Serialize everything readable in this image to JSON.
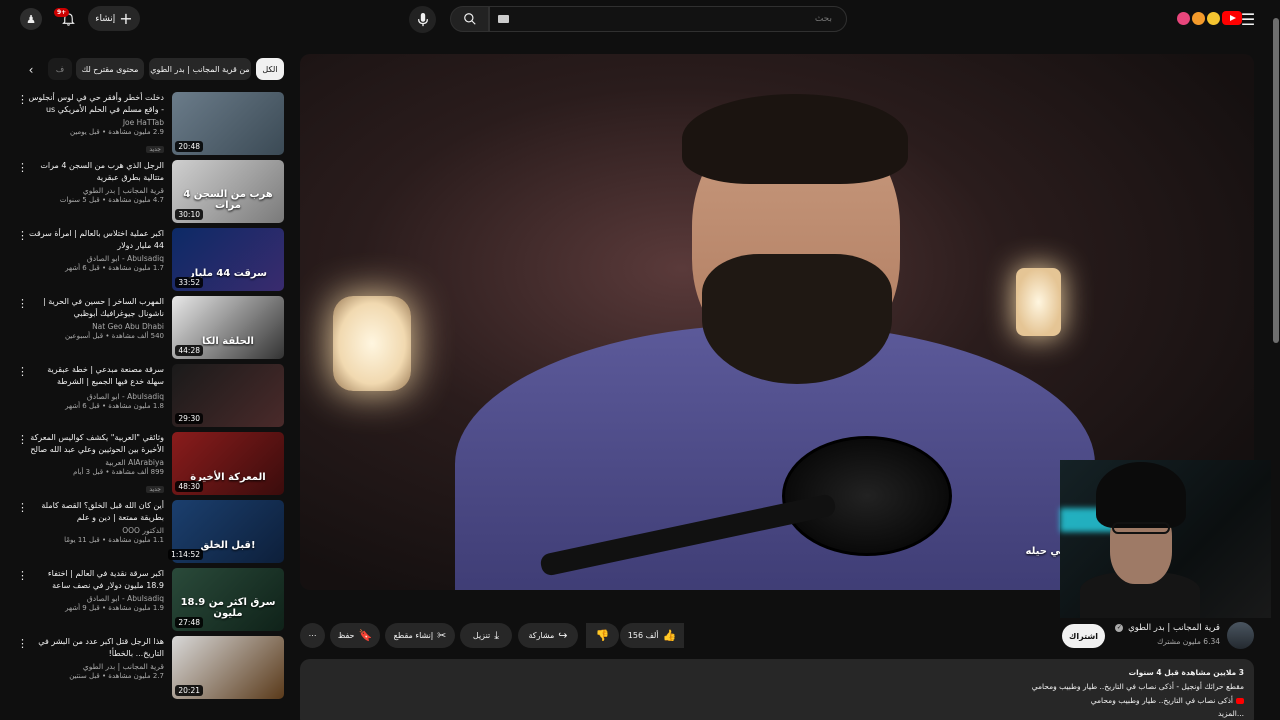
{
  "topbar": {
    "search_placeholder": "بحث",
    "create_label": "إنشاء",
    "notifications_badge": "9+",
    "colors": {
      "brand": "#ff0000",
      "badge": "#cc0000"
    }
  },
  "chips": [
    "الكل",
    "من قرية المجانب | بدر الطوي",
    "محتوى مقترح لك",
    "ف"
  ],
  "recommendations": [
    {
      "title": "دخلت أخطر وأفقر حي في لوس أنجلوس - واقع مسلم في الحلم الأمريكي us",
      "channel": "Joe HaTTab",
      "meta": "2.9 مليون مشاهدة • قبل يومين",
      "tag": "جديد",
      "duration": "20:48",
      "colors": [
        "#6b7c8a",
        "#3b4a55"
      ],
      "thumb_text": ""
    },
    {
      "title": "الرجل الذي هرب من السجن 4 مرات متتالية بطرق عبقرية",
      "channel": "قرية المجانب | بدر الطوي",
      "meta": "4.7 مليون مشاهدة • قبل 5 سنوات",
      "tag": "",
      "duration": "30:10",
      "colors": [
        "#cfcfcf",
        "#7a7a7a"
      ],
      "thumb_text": "هرب من السجن 4 مرات"
    },
    {
      "title": "اكبر عملية اختلاس بالعالم | امرأة سرقت 44 مليار دولار",
      "channel": "Abulsadiq - ابو الصادق",
      "meta": "1.7 مليون مشاهدة • قبل 6 أشهر",
      "tag": "",
      "duration": "33:52",
      "colors": [
        "#0c2a66",
        "#3a2b6e"
      ],
      "thumb_text": "سرقت 44 مليار"
    },
    {
      "title": "المهرب الساخر | حسين في الحرية | ناشونال جيوغرافيك أبوظبي",
      "channel": "Nat Geo Abu Dhabi",
      "meta": "540 ألف مشاهدة • قبل أسبوعين",
      "tag": "",
      "duration": "44:28",
      "colors": [
        "#e8e8e8",
        "#333"
      ],
      "thumb_text": "الحلقة الكا"
    },
    {
      "title": "سرقة مصنعة مبدعي | خطة عبقرية سهلة خدع فيها الجميع | الشرطة والمسابقة",
      "channel": "Abulsadiq - ابو الصادق",
      "meta": "1.8 مليون مشاهدة • قبل 6 أشهر",
      "tag": "",
      "duration": "29:30",
      "colors": [
        "#1a1a1a",
        "#4a2a2a"
      ],
      "thumb_text": ""
    },
    {
      "title": "وثائقي \"العربية\" يكشف كواليس المعركة الأخيرة بين الحوثيين وعلي عبد الله صالح",
      "channel": "AlArabiya العربية",
      "meta": "899 ألف مشاهدة • قبل 3 أيام",
      "tag": "جديد",
      "duration": "48:30",
      "colors": [
        "#8a1c1c",
        "#3a0c0c"
      ],
      "thumb_text": "المعركة الأخيرة"
    },
    {
      "title": "أين كان الله قبل الخلق؟ القصة كاملة بطريقة ممتعة | دين و علم",
      "channel": "الدكتور OOO",
      "meta": "1.1 مليون مشاهدة • قبل 11 يومًا",
      "tag": "",
      "duration": "1:14:52",
      "colors": [
        "#1b3f6e",
        "#0d1f3a"
      ],
      "thumb_text": "قبل الخلق!"
    },
    {
      "title": "اكبر سرقة نقدية في العالم | اختفاء 18.9 مليون دولار في نصف ساعة",
      "channel": "Abulsadiq - ابو الصادق",
      "meta": "1.9 مليون مشاهدة • قبل 9 أشهر",
      "tag": "",
      "duration": "27:48",
      "colors": [
        "#2a4a3a",
        "#0f2219"
      ],
      "thumb_text": "سرق اكثر من 18.9 مليون"
    },
    {
      "title": "هذا الرجل قتل اكبر عدد من البشر في التاريخ... بالخطأ!",
      "channel": "قرية المجانب | بدر الطوي",
      "meta": "2.7 مليون مشاهدة • قبل سنتين",
      "tag": "",
      "duration": "20:21",
      "colors": [
        "#d8d8d8",
        "#5a3a1a"
      ],
      "thumb_text": ""
    }
  ],
  "video": {
    "caption": "لا تنتهي حيله",
    "channel_name": "قرية المجانب | بدر الطوي",
    "channel_subs": "6.34 مليون مشترك",
    "subscribe_label": "اشتراك",
    "likes": "156 ألف",
    "share_label": "مشاركة",
    "download_label": "تنزيل",
    "clip_label": "إنشاء مقطع",
    "save_label": "حفظ"
  },
  "description": {
    "line1": "3 ملايين مشاهدة  قبل 4 سنوات",
    "line2": "مقطع حرائك أونجيل - أذكى نصاب في التاريخ.. طيار وطبيب ومحامي",
    "line3": "أذكى نصاب في التاريخ.. طيار وطبيب ومحامي",
    "line4": "...المزيد"
  }
}
